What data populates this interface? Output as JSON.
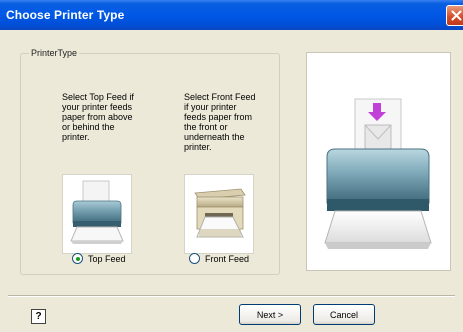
{
  "window": {
    "title": "Choose Printer Type",
    "close_icon": "close-icon"
  },
  "group": {
    "legend": "PrinterType"
  },
  "top_feed": {
    "description": "Select Top Feed if\nyour printer feeds\npaper from above\nor behind the\nprinter.",
    "label": "Top Feed",
    "selected": true,
    "image": "printer-top-feed-icon"
  },
  "front_feed": {
    "description": "Select Front Feed\nif your printer\nfeeds paper from\nthe front or\nunderneath the\nprinter.",
    "label": "Front Feed",
    "selected": false,
    "image": "printer-front-feed-icon"
  },
  "preview": {
    "image": "printer-preview-icon"
  },
  "footer": {
    "help_label": "?",
    "next_label": "Next >",
    "cancel_label": "Cancel"
  },
  "colors": {
    "titlebar": "#0058e6",
    "dialog_bg": "#ece9d8",
    "arrow": "#c040d8"
  }
}
